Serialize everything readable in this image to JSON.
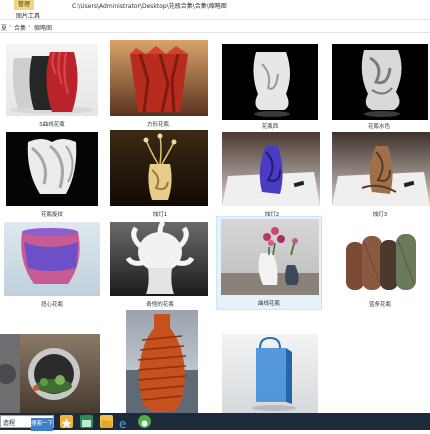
{
  "window": {
    "manage_tab": "管理",
    "path_title": "C:\\Users\\Administrator\\Desktop\\花瓶合集\\合集\\缩略图",
    "ribbon_tab": "图片工具"
  },
  "address": {
    "segments": [
      "夏",
      "合集",
      "缩略图"
    ]
  },
  "items": [
    {
      "label": "S曲线花瓶"
    },
    {
      "label": "方形花瓶"
    },
    {
      "label": "花瓶西"
    },
    {
      "label": "花瓶水色"
    },
    {
      "label": "花瓶旋纹"
    },
    {
      "label": "烛灯1"
    },
    {
      "label": "烛灯2"
    },
    {
      "label": "烛灯3"
    },
    {
      "label": "扭心花瓶"
    },
    {
      "label": "奇怪的花瓶"
    },
    {
      "label": "曲线花瓶"
    },
    {
      "label": "蓝条花瓶"
    },
    {
      "label": ""
    },
    {
      "label": ""
    },
    {
      "label": ""
    }
  ],
  "taskbar": {
    "search_value": "造程",
    "search_button": "搜索一下"
  },
  "colors": {
    "selection": "#e5f1fb",
    "manage_tab": "#f3d77a",
    "taskbar": "#1c2a3a"
  }
}
